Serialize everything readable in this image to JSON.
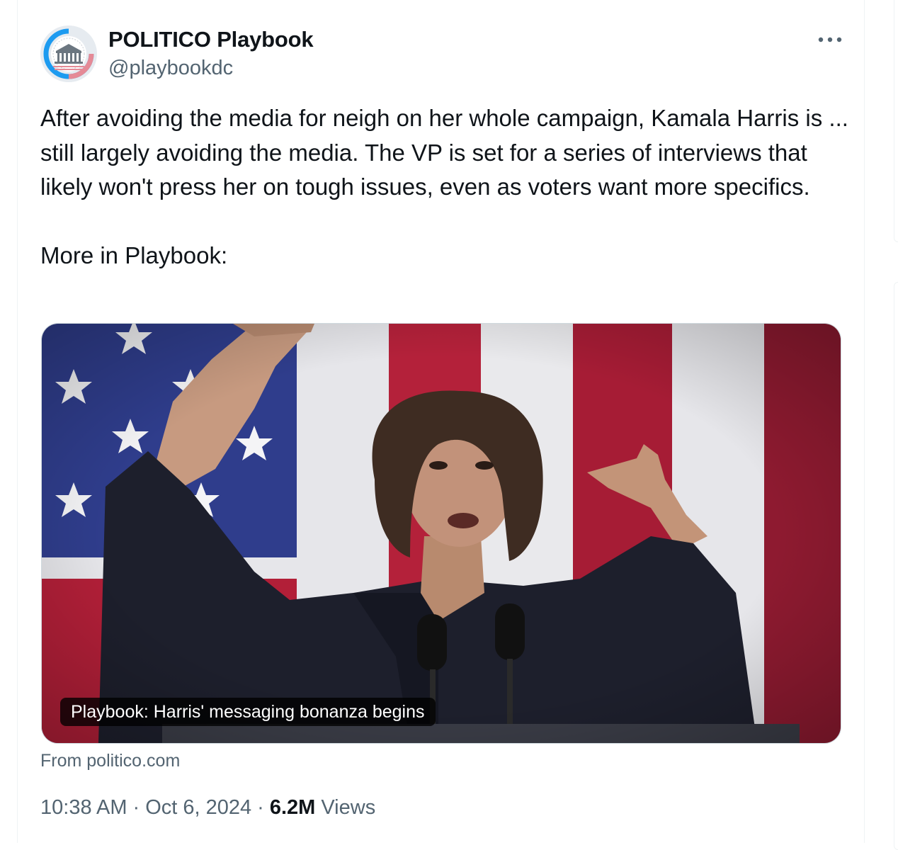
{
  "account": {
    "display_name": "POLITICO Playbook",
    "handle": "@playbookdc",
    "avatar_icon": "white-house-logo-icon"
  },
  "tweet": {
    "text": "After avoiding the media for neigh on her whole campaign, Kamala Harris is ... still largely avoiding the media. The VP is set for a series of interviews that likely won't press her on tough issues, even as voters want more specifics.\n\nMore in Playbook:"
  },
  "link_card": {
    "title": "Playbook: Harris' messaging bonanza begins",
    "source": "From politico.com"
  },
  "meta": {
    "time": "10:38 AM",
    "separator": "·",
    "date": "Oct 6, 2024",
    "views_count": "6.2M",
    "views_label": "Views"
  },
  "colors": {
    "text_primary": "#0f1419",
    "text_secondary": "#536471",
    "border": "#cfd9de",
    "flag_red": "#a51d34",
    "flag_blue": "#36458f",
    "avatar_accent": "#1d9bf0"
  }
}
